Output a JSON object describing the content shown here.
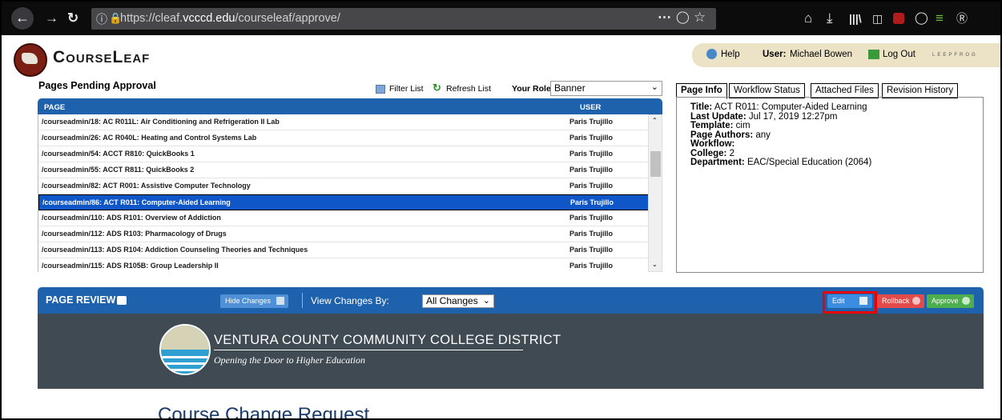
{
  "browser": {
    "url_prefix": "https://cleaf.",
    "url_domain": "vcccd.edu",
    "url_path": "/courseleaf/approve/",
    "icons": [
      "back-icon",
      "forward-icon",
      "reload-icon",
      "info-icon",
      "lock-icon",
      "page-actions-icon",
      "pocket-icon",
      "bookmark-star-icon",
      "home-icon",
      "download-icon",
      "library-icon",
      "sidebar-icon",
      "ublock-icon",
      "chat-icon",
      "extension-icon",
      "wordpress-icon"
    ]
  },
  "app": {
    "brand": "CourseLeaf",
    "help_label": "Help",
    "user_prefix": "User:",
    "user_name": "Michael Bowen",
    "logout_label": "Log Out",
    "vendor_mark": "LEEPFROG"
  },
  "pending": {
    "title": "Pages Pending Approval",
    "filter_label": "Filter List",
    "refresh_label": "Refresh List",
    "role_label": "Your Role:",
    "role_value": "Banner",
    "col_page": "PAGE",
    "col_user": "USER",
    "rows": [
      {
        "page": "/courseadmin/18: AC R011L: Air Conditioning and Refrigeration II Lab",
        "user": "Paris Trujillo",
        "selected": false
      },
      {
        "page": "/courseadmin/26: AC R040L: Heating and Control Systems Lab",
        "user": "Paris Trujillo",
        "selected": false
      },
      {
        "page": "/courseadmin/54: ACCT R810: QuickBooks 1",
        "user": "Paris Trujillo",
        "selected": false
      },
      {
        "page": "/courseadmin/55: ACCT R811: QuickBooks 2",
        "user": "Paris Trujillo",
        "selected": false
      },
      {
        "page": "/courseadmin/82: ACT R001: Assistive Computer Technology",
        "user": "Paris Trujillo",
        "selected": false
      },
      {
        "page": "/courseadmin/86: ACT R011: Computer-Aided Learning",
        "user": "Paris Trujillo",
        "selected": true
      },
      {
        "page": "/courseadmin/110: ADS R101: Overview of Addiction",
        "user": "Paris Trujillo",
        "selected": false
      },
      {
        "page": "/courseadmin/112: ADS R103: Pharmacology of Drugs",
        "user": "Paris Trujillo",
        "selected": false
      },
      {
        "page": "/courseadmin/113: ADS R104: Addiction Counseling Theories and Techniques",
        "user": "Paris Trujillo",
        "selected": false
      },
      {
        "page": "/courseadmin/115: ADS R105B: Group Leadership II",
        "user": "Paris Trujillo",
        "selected": false
      }
    ]
  },
  "tabs": [
    "Page Info",
    "Workflow Status",
    "Attached Files",
    "Revision History"
  ],
  "info": {
    "title_k": "Title:",
    "title_v": "ACT R011: Computer-Aided Learning",
    "update_k": "Last Update:",
    "update_v": "Jul 17, 2019 12:27pm",
    "template_k": "Template:",
    "template_v": "cim",
    "authors_k": "Page Authors:",
    "authors_v": "any",
    "workflow_k": "Workflow:",
    "workflow_v": "",
    "college_k": "College:",
    "college_v": "2",
    "dept_k": "Department:",
    "dept_v": "EAC/Special Education (2064)"
  },
  "review": {
    "title": "PAGE REVIEW",
    "hide_changes": "Hide Changes",
    "view_changes_label": "View Changes By:",
    "view_changes_value": "All Changes",
    "edit_label": "Edit",
    "rollback_label": "Rollback",
    "approve_label": "Approve",
    "district_name": "VENTURA COUNTY COMMUNITY COLLEGE DISTRICT",
    "district_tagline": "Opening the Door to Higher Education",
    "doc_title": "Course Change Request",
    "colors": {
      "header_blue": "#1e62ad",
      "edit_blue": "#3c8de0",
      "rollback_red": "#e34a4a",
      "approve_green": "#4cae4c",
      "banner_gray": "#3f4a52"
    }
  }
}
